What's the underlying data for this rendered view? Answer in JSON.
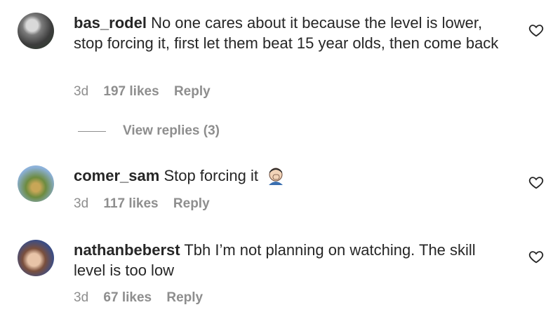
{
  "comments": [
    {
      "username": "bas_rodel",
      "text": "No one cares about it because the level is lower, stop forcing it, first let them beat 15 year olds, then come back",
      "time": "3d",
      "likes": "197 likes",
      "reply": "Reply",
      "view_replies": "View replies (3)",
      "avatar_icon": "user-photo"
    },
    {
      "username": "comer_sam",
      "text": "Stop forcing it",
      "emoji": "face-palm-emoji",
      "time": "3d",
      "likes": "117 likes",
      "reply": "Reply",
      "avatar_icon": "user-photo"
    },
    {
      "username": "nathanbeberst",
      "text": "Tbh I’m not planning on watching. The skill level is too low",
      "time": "3d",
      "likes": "67 likes",
      "reply": "Reply",
      "avatar_icon": "user-photo"
    }
  ],
  "colors": {
    "text": "#262626",
    "muted": "#8e8e8e"
  }
}
